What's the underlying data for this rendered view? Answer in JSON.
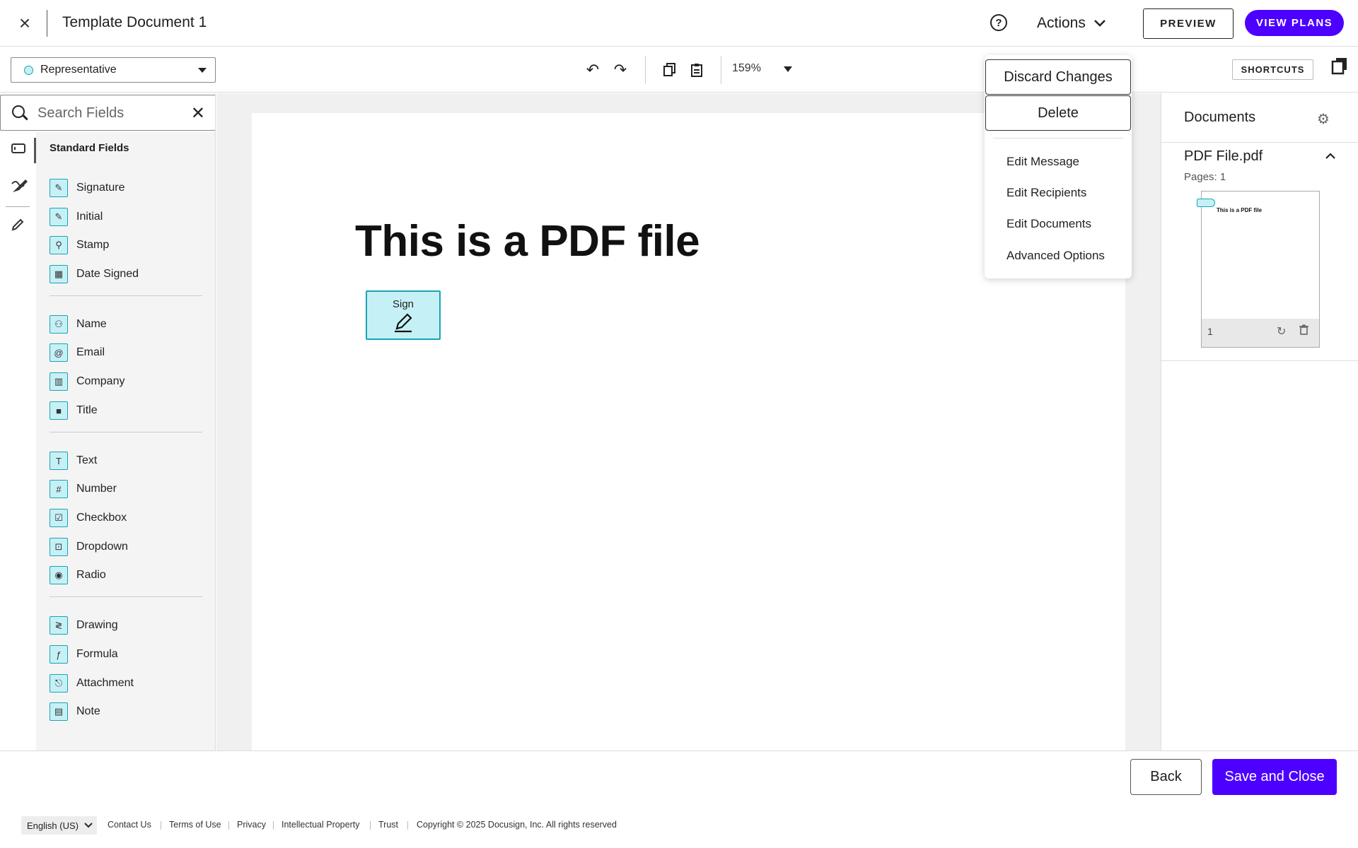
{
  "header": {
    "close_glyph": "×",
    "title": "Template Document 1",
    "actions_label": "Actions",
    "preview_label": "PREVIEW",
    "view_plans_label": "VIEW PLANS"
  },
  "toolbar": {
    "recipient": "Representative",
    "zoom": "159%",
    "shortcuts_label": "SHORTCUTS"
  },
  "left_panel": {
    "search_placeholder": "Search Fields",
    "section_label": "Standard Fields",
    "groups": [
      [
        {
          "label": "Signature",
          "icon": "signature-icon",
          "glyph": "✎"
        },
        {
          "label": "Initial",
          "icon": "initial-icon",
          "glyph": "✎"
        },
        {
          "label": "Stamp",
          "icon": "stamp-icon",
          "glyph": "⚲"
        },
        {
          "label": "Date Signed",
          "icon": "calendar-icon",
          "glyph": "▦"
        }
      ],
      [
        {
          "label": "Name",
          "icon": "person-icon",
          "glyph": "⚇"
        },
        {
          "label": "Email",
          "icon": "at-icon",
          "glyph": "@"
        },
        {
          "label": "Company",
          "icon": "building-icon",
          "glyph": "▥"
        },
        {
          "label": "Title",
          "icon": "briefcase-icon",
          "glyph": "■"
        }
      ],
      [
        {
          "label": "Text",
          "icon": "text-icon",
          "glyph": "T"
        },
        {
          "label": "Number",
          "icon": "hash-icon",
          "glyph": "#"
        },
        {
          "label": "Checkbox",
          "icon": "checkbox-icon",
          "glyph": "☑"
        },
        {
          "label": "Dropdown",
          "icon": "dropdown-icon",
          "glyph": "⊡"
        },
        {
          "label": "Radio",
          "icon": "radio-icon",
          "glyph": "◉"
        }
      ],
      [
        {
          "label": "Drawing",
          "icon": "drawing-icon",
          "glyph": "≷"
        },
        {
          "label": "Formula",
          "icon": "formula-icon",
          "glyph": "ƒ"
        },
        {
          "label": "Attachment",
          "icon": "paperclip-icon",
          "glyph": "⎋"
        },
        {
          "label": "Note",
          "icon": "note-icon",
          "glyph": "▤"
        }
      ]
    ]
  },
  "document": {
    "heading": "This is a PDF file",
    "sign_field_label": "Sign"
  },
  "actions_menu": {
    "discard_label": "Discard Changes",
    "delete_label": "Delete",
    "items": [
      "Edit Message",
      "Edit Recipients",
      "Edit Documents",
      "Advanced Options"
    ]
  },
  "right_panel": {
    "title": "Documents",
    "file_name": "PDF File.pdf",
    "pages_label": "Pages: 1",
    "thumb_title": "This is a PDF file",
    "page_number": "1"
  },
  "bottom_bar": {
    "back_label": "Back",
    "save_label": "Save and Close"
  },
  "footer": {
    "language": "English (US)",
    "links": [
      "Contact Us",
      "Terms of Use",
      "Privacy",
      "Intellectual Property",
      "Trust"
    ],
    "copyright": "Copyright © 2025 Docusign, Inc. All rights reserved"
  },
  "colors": {
    "brand_purple": "#4c00ff",
    "field_fill": "#c5f1f6",
    "field_border": "#1aa3b3"
  }
}
